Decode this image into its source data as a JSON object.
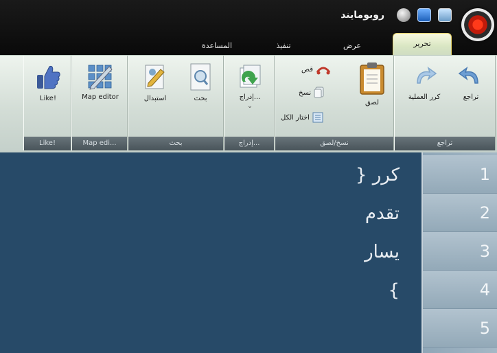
{
  "window": {
    "app_title": "روبومايند",
    "quick_access": [
      {
        "icon": "info-icon"
      },
      {
        "icon": "stack-icon"
      },
      {
        "icon": "image-icon"
      }
    ],
    "logo_icon": "app-logo-icon"
  },
  "tabs": [
    {
      "label": "تحرير",
      "active": true
    },
    {
      "label": "عرض",
      "active": false
    },
    {
      "label": "تنفيذ",
      "active": false
    },
    {
      "label": "المساعدة",
      "active": false
    }
  ],
  "ribbon": {
    "undo_group": {
      "label": "تراجع",
      "undo": "تراجع",
      "repeat": "كرر العملية"
    },
    "clipboard_group": {
      "label": "نسخ/لصق",
      "paste": "لصق",
      "cut": "قص",
      "copy": "نسخ",
      "select_all": "اختار الكل"
    },
    "insert_group": {
      "label": "إدراج...",
      "insert": "إدراج...",
      "dropdown": "⌄"
    },
    "search_group": {
      "label": "بحث",
      "search": "بحث",
      "replace": "استبدال"
    },
    "map_group": {
      "label": "Map edi...",
      "map_editor": "Map editor"
    },
    "like_group": {
      "label": "Like!",
      "like": "Like!"
    }
  },
  "editor": {
    "lines": [
      {
        "number": "1",
        "text": "كرر {"
      },
      {
        "number": "2",
        "text": "تقدم"
      },
      {
        "number": "3",
        "text": "يسار"
      },
      {
        "number": "4",
        "text": "}"
      },
      {
        "number": "5",
        "text": ""
      }
    ]
  },
  "colors": {
    "editor_bg": "#274a68",
    "ribbon_bg": "#d3ddd6",
    "titlebar_bg": "#0f0f0f",
    "active_tab_border": "#e8d46a"
  }
}
